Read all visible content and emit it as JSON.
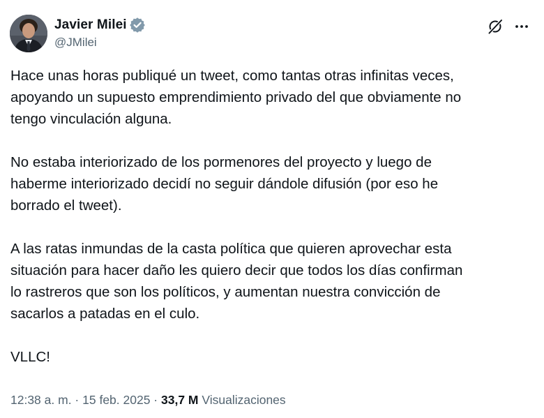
{
  "author": {
    "display_name": "Javier Milei",
    "handle": "@JMilei",
    "verified": true,
    "avatar_alt": "Javier Milei"
  },
  "actions": {
    "grok_icon": "grok-icon",
    "more_icon": "more-options-icon"
  },
  "tweet": {
    "paragraphs": [
      "Hace unas horas publiqué un tweet, como tantas otras infinitas veces,\napoyando un supuesto emprendimiento privado del que obviamente no\ntengo vinculación alguna.",
      "No estaba interiorizado de los pormenores del proyecto y luego de\nhaberme interiorizado decidí no seguir dándole difusión (por eso he\nborrado el tweet).",
      "A las ratas inmundas de la casta política que quieren aprovechar esta\nsituación para hacer daño les quiero decir que todos los días confirman\nlo rastreros que son los políticos, y aumentan nuestra convicción de\nsacarlos a patadas en el culo.",
      "VLLC!"
    ]
  },
  "meta": {
    "time": "12:38 a. m.",
    "separator_1": " · ",
    "date": "15 feb. 2025",
    "separator_2": " · ",
    "views_count": "33,7 M",
    "views_label": " Visualizaciones"
  },
  "colors": {
    "text_primary": "#0f1419",
    "text_secondary": "#536471",
    "verified_blue": "#829aab"
  }
}
